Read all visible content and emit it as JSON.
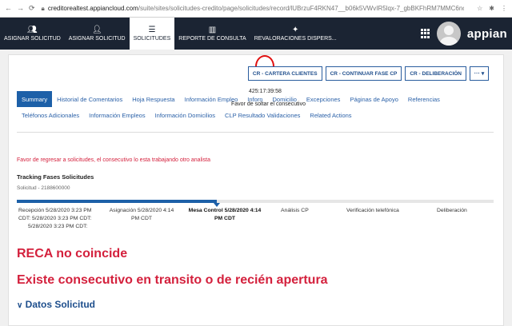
{
  "browser": {
    "url_host": "creditorealtest.appiancloud.com",
    "url_path": "/suite/sites/solicitudes-credito/page/solicitudes/record/lUBrzuF4RKN47__b06k5VWvIR5lqx-7_gbBKFhRM7MMC6ncpQg7847..."
  },
  "topnav": {
    "tabs": [
      {
        "label": "ASIGNAR SOLICITUD",
        "icon": "user-plus-icon"
      },
      {
        "label": "ASIGNAR SOLICITUD",
        "icon": "user-plus-icon"
      },
      {
        "label": "SOLICITUDES",
        "icon": "list-icon"
      },
      {
        "label": "REPORTE DE CONSULTA",
        "icon": "bar-chart-icon"
      },
      {
        "label": "REVALORACIONES DISPERS...",
        "icon": "star-icon"
      }
    ],
    "active_index": 2,
    "brand": "appian"
  },
  "actions": {
    "buttons": [
      "CR - CARTERA CLIENTES",
      "CR - CONTINUAR FASE CP",
      "CR - DELIBERACIÓN"
    ],
    "more": "···  ▾"
  },
  "overlay": {
    "timer": "425:17:39:58",
    "tooltip": "Favor de soltar el consecutivo"
  },
  "subtabs": {
    "row1": [
      "Summary",
      "Historial de Comentarios",
      "Hoja Respuesta",
      "Información Empleo",
      "Inforn",
      "Domicilio",
      "Excepciones",
      "Páginas de Apoyo",
      "Referencias"
    ],
    "row2": [
      "Teléfonos Adicionales",
      "Información Empleos",
      "Información Domicilios",
      "CLP Resultado Validaciones",
      "Related Actions"
    ]
  },
  "warning": "Favor de regresar a solicitudes, el consecutivo lo esta trabajando otro analista",
  "tracking": {
    "title": "Tracking Fases Solicitudes",
    "solicitud": "Solicitud - 2188600000",
    "progress_fraction": 0.42,
    "phases": [
      {
        "label": "Recepción 5/28/2020 3:23 PM CDT: 5/28/2020 3:23 PM CDT: 5/28/2020 3:23 PM CDT",
        "line1": "Recepción 5/28/2020 3:23 PM",
        "line2": "CDT: 5/28/2020 3:23 PM CDT:",
        "line3": "5/28/2020 3:23 PM CDT:"
      },
      {
        "line1": "Asignación 5/28/2020 4:14",
        "line2": "PM CDT"
      },
      {
        "line1": "Mesa Control 5/28/2020 4:14",
        "line2": "PM CDT"
      },
      {
        "line1": "Análisis CP"
      },
      {
        "line1": "Verificación telefónica"
      },
      {
        "line1": "Deliberación"
      }
    ]
  },
  "messages": {
    "reca": "RECA no coincide",
    "consecutivo": "Existe consecutivo en transito o de recién apertura"
  },
  "section": {
    "title": "Datos Solicitud"
  }
}
